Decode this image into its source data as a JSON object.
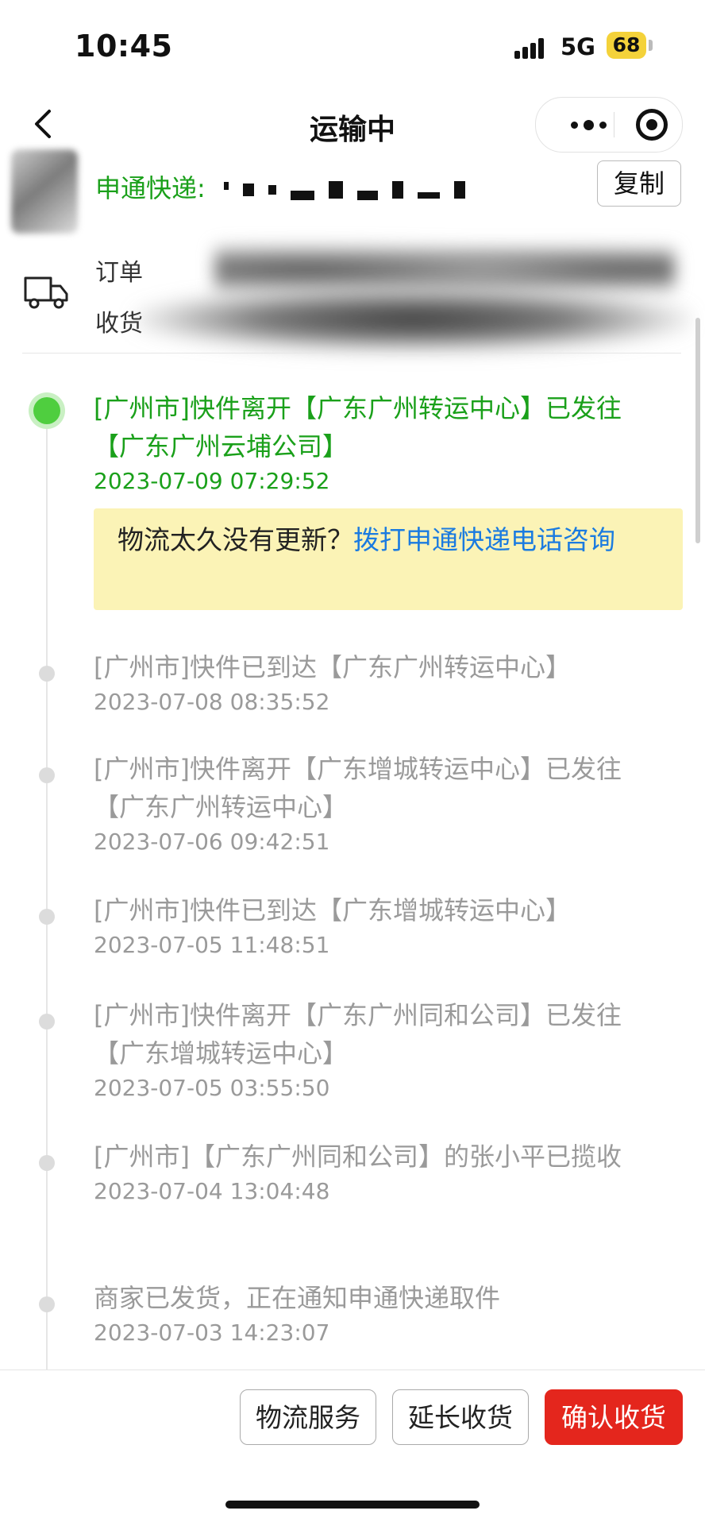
{
  "status_bar": {
    "time": "10:45",
    "network": "5G",
    "battery": "68"
  },
  "nav": {
    "title": "运输中",
    "back_icon": "chevron-left-icon",
    "more_icon": "more-dots-icon",
    "close_icon": "mini-program-close-icon"
  },
  "courier": {
    "label": "申通快递:",
    "copy_label": "复制"
  },
  "address": {
    "order_label": "订单",
    "receiver_label": "收货"
  },
  "timeline": [
    {
      "text": "[广州市]快件离开【广东广州转运中心】已发往【广东广州云埔公司】",
      "time": "2023-07-09 07:29:52",
      "active": true
    },
    {
      "text": "[广州市]快件已到达【广东广州转运中心】",
      "time": "2023-07-08 08:35:52"
    },
    {
      "text": "[广州市]快件离开【广东增城转运中心】已发往【广东广州转运中心】",
      "time": "2023-07-06 09:42:51"
    },
    {
      "text": "[广州市]快件已到达【广东增城转运中心】",
      "time": "2023-07-05 11:48:51"
    },
    {
      "text": "[广州市]快件离开【广东广州同和公司】已发往【广东增城转运中心】",
      "time": "2023-07-05 03:55:50"
    },
    {
      "text": "[广州市]【广东广州同和公司】的张小平已揽收",
      "time": "2023-07-04 13:04:48"
    },
    {
      "text": "商家已发货，正在通知申通快递取件",
      "time": "2023-07-03 14:23:07"
    }
  ],
  "notice": {
    "text": "物流太久没有更新？",
    "link": "拨打申通快递电话咨询"
  },
  "actions": {
    "logistics_service": "物流服务",
    "extend_receipt": "延长收货",
    "confirm_receipt": "确认收货"
  },
  "colors": {
    "active_green": "#1aa01a",
    "primary_red": "#e4261d",
    "link_blue": "#1b7be0",
    "notice_bg": "#fbf3b6"
  }
}
